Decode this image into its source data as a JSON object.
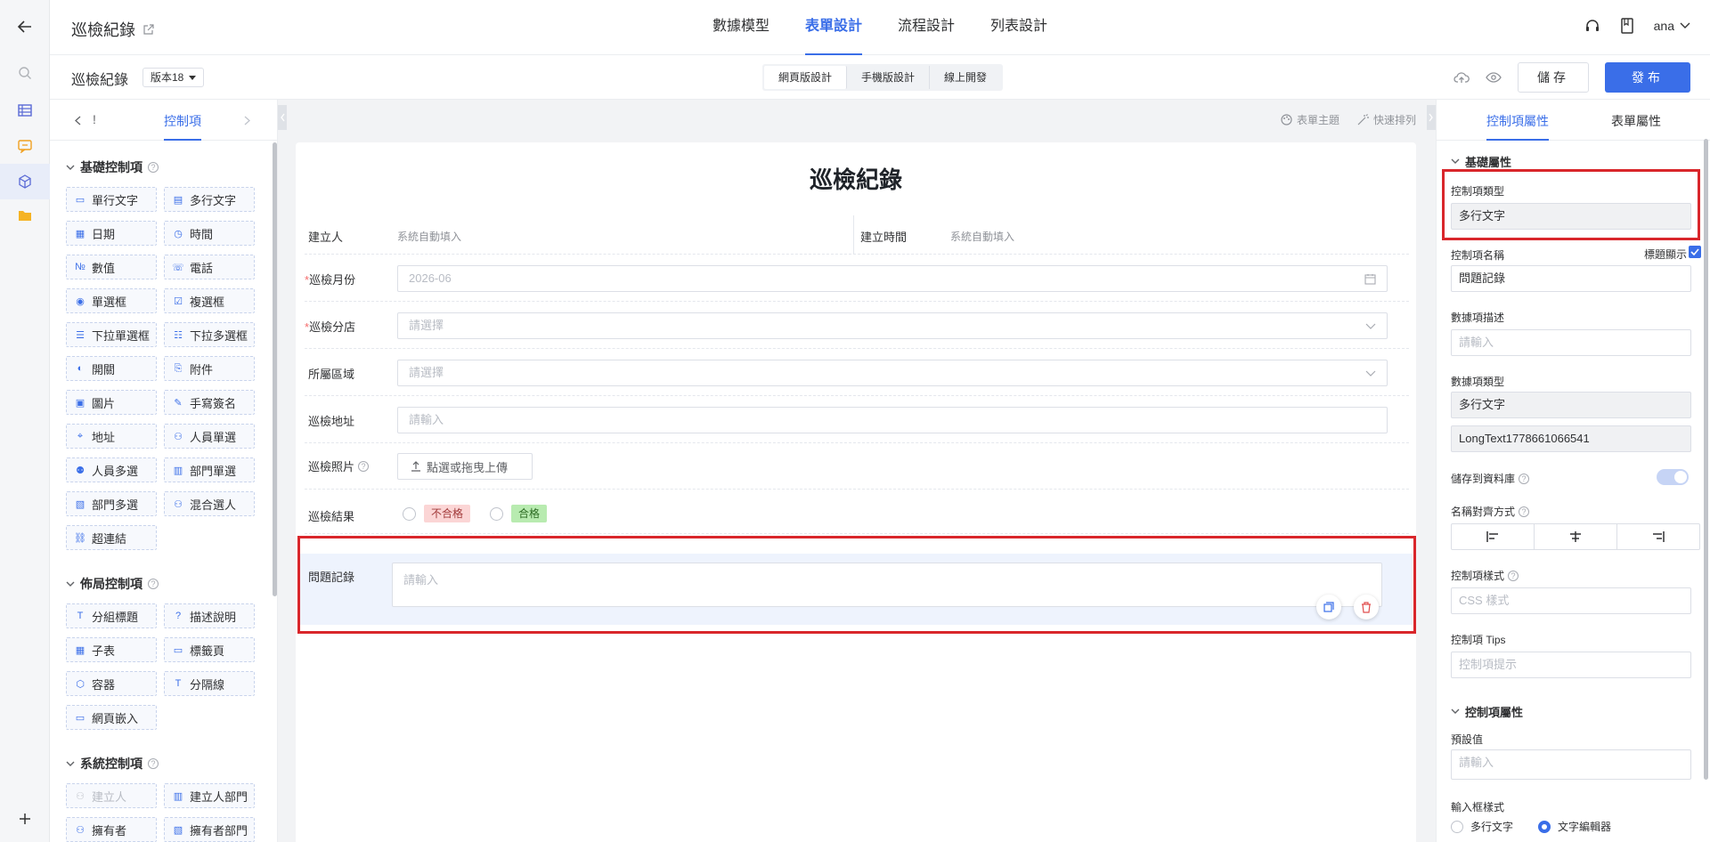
{
  "app": {
    "title": "巡檢紀錄",
    "user": "ana"
  },
  "nav": {
    "tabs": [
      "數據模型",
      "表單設計",
      "流程設計",
      "列表設計"
    ],
    "active": 1
  },
  "sub": {
    "form_name": "巡檢紀錄",
    "version": "版本18",
    "modes": [
      "網頁版設計",
      "手機版設計",
      "線上開發"
    ],
    "save": "儲存",
    "publish": "發布"
  },
  "left": {
    "tab_prev": "!",
    "tab_active": "控制項",
    "basic_title": "基礎控制項",
    "basic": [
      "單行文字",
      "多行文字",
      "日期",
      "時間",
      "數值",
      "電話",
      "單選框",
      "複選框",
      "下拉單選框",
      "下拉多選框",
      "開關",
      "附件",
      "圖片",
      "手寫簽名",
      "地址",
      "人員單選",
      "人員多選",
      "部門單選",
      "部門多選",
      "混合選人",
      "超連結"
    ],
    "layout_title": "佈局控制項",
    "layout": [
      "分組標題",
      "描述說明",
      "子表",
      "標籤頁",
      "容器",
      "分隔線",
      "網頁嵌入"
    ],
    "system_title": "系統控制項",
    "system": [
      "建立人",
      "建立人部門",
      "擁有者",
      "擁有者部門"
    ]
  },
  "canvas": {
    "tools": [
      "表單主題",
      "快速排列"
    ],
    "title": "巡檢紀錄",
    "creator_label": "建立人",
    "creator_value": "系統自動填入",
    "created_label": "建立時間",
    "created_value": "系統自動填入",
    "month_label": "巡檢月份",
    "month_value": "2026-06",
    "store_label": "巡檢分店",
    "store_ph": "請選擇",
    "region_label": "所屬區域",
    "region_ph": "請選擇",
    "addr_label": "巡檢地址",
    "addr_ph": "請輸入",
    "photo_label": "巡檢照片",
    "upload": "點選或拖曳上傳",
    "result_label": "巡檢結果",
    "fail": "不合格",
    "pass": "合格",
    "issue_label": "問題記錄",
    "issue_ph": "請輸入"
  },
  "right": {
    "tabs": [
      "控制項屬性",
      "表單屬性"
    ],
    "sec_basic": "基礎屬性",
    "type_label": "控制項類型",
    "type_value": "多行文字",
    "name_label": "控制項名稱",
    "show_title": "標題顯示",
    "name_value": "問題記錄",
    "desc_label": "數據項描述",
    "desc_ph": "請輸入",
    "dtype_label": "數據項類型",
    "dtype_value": "多行文字",
    "dtype_id": "LongText1778661066541",
    "store_db": "儲存到資料庫",
    "align_label": "名稱對齊方式",
    "style_label": "控制項樣式",
    "style_ph": "CSS 樣式",
    "tips_label": "控制項 Tips",
    "tips_ph": "控制項提示",
    "sec_ctl": "控制項屬性",
    "default_label": "預設值",
    "default_ph": "請輸入",
    "input_style_label": "輸入框樣式",
    "opt_multi": "多行文字",
    "opt_editor": "文字編輯器"
  },
  "colors": {
    "accent": "#3a6ee8",
    "highlight": "#d9262b",
    "fail_bg": "#fbd5d5",
    "pass_bg": "#b8ebb0"
  }
}
